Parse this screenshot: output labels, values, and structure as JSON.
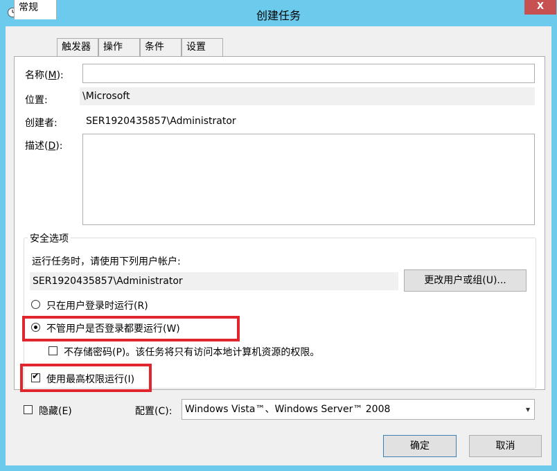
{
  "window": {
    "title": "创建任务",
    "close_label": "X"
  },
  "tabs": [
    {
      "label": "常规"
    },
    {
      "label": "触发器"
    },
    {
      "label": "操作"
    },
    {
      "label": "条件"
    },
    {
      "label": "设置"
    }
  ],
  "general": {
    "name_label": "名称(",
    "name_key": "M",
    "name_label_end": "):",
    "name_value": "",
    "location_label": "位置:",
    "location_value": "\\Microsoft",
    "author_label": "创建者:",
    "author_value": "SER1920435857\\Administrator",
    "description_label": "描述(",
    "description_key": "D",
    "description_label_end": "):",
    "description_value": ""
  },
  "security": {
    "group_title": "安全选项",
    "run_as_prompt": "运行任务时，请使用下列用户帐户:",
    "account_value": "SER1920435857\\Administrator",
    "change_user_button": "更改用户或组(U)...",
    "radio_logged_on": "只在用户登录时运行(R)",
    "radio_whether_logged": "不管用户是否登录都要运行(W)",
    "do_not_store_password": "不存储密码(P)。该任务将只有访问本地计算机资源的权限。",
    "run_highest": "使用最高权限运行(I)",
    "selected_option": "radio_whether_logged",
    "run_highest_checked": true,
    "do_not_store_checked": false
  },
  "bottom": {
    "hidden_label": "隐藏(E)",
    "hidden_checked": false,
    "configure_label": "配置(C):",
    "configure_value": "Windows Vista™、Windows Server™ 2008",
    "ok_button": "确定",
    "cancel_button": "取消"
  },
  "colors": {
    "titlebar": "#6ccbed",
    "close_button": "#c75050",
    "highlight_border": "#e0262c"
  }
}
